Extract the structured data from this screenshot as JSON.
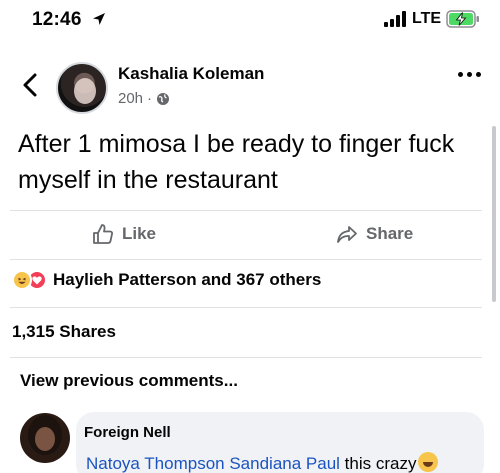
{
  "status_bar": {
    "time": "12:46",
    "network": "LTE"
  },
  "post": {
    "author": "Kashalia Koleman",
    "time_ago": "20h",
    "separator": "·",
    "text": "After 1 mimosa I be ready to finger fuck myself in the restaurant",
    "actions": {
      "like_label": "Like",
      "share_label": "Share"
    },
    "reactions_text": "Haylieh Patterson and 367 others",
    "shares_text": "1,315 Shares",
    "view_previous_label": "View previous comments..."
  },
  "comment": {
    "author": "Foreign Nell",
    "mention_1": "Natoya Thompson",
    "mention_2": "Sandiana Paul",
    "text": "this crazy"
  },
  "colors": {
    "text": "#050505",
    "secondary": "#65676b",
    "mention": "#1b54c0",
    "bubble": "#f0f2f5",
    "haha": "#f7c44c",
    "love": "#f33e58",
    "battery_charging": "#4cd964"
  },
  "icons": [
    "location-arrow-icon",
    "signal-icon",
    "battery-charging-icon",
    "back-chevron-icon",
    "globe-icon",
    "more-icon",
    "like-icon",
    "share-icon",
    "haha-reaction-icon",
    "love-reaction-icon",
    "laughing-emoji-icon"
  ]
}
